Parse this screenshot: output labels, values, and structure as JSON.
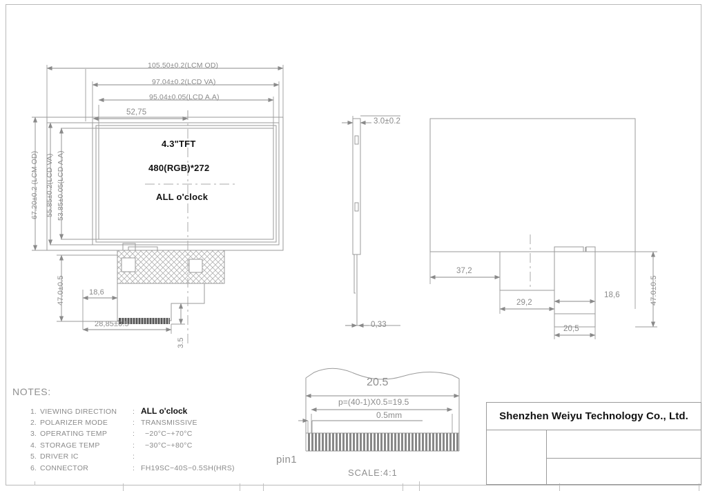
{
  "drawing": {
    "front_view": {
      "panel_texts": {
        "type": "4.3\"TFT",
        "resolution": "480(RGB)*272",
        "viewing": "ALL  o'clock"
      },
      "horizontal_dims": [
        "105.50±0.2(LCM  OD)",
        "97.04±0.2(LCD  VA)",
        "95.04±0.05(LCD  A.A)",
        "52,75"
      ],
      "vertical_dims": [
        "67.20±0.2  (LCM  OD)",
        "55.85±0.2(LCD  VA)",
        "53.85±0.05(LCD  A.A)",
        "47.0±0.5"
      ],
      "fpc_dims": [
        "18,6",
        "28,85±0.5",
        "3.5"
      ]
    },
    "side_view": {
      "thickness": "3.0±0.2",
      "fpc_thickness": "0,33"
    },
    "rear_view": {
      "dims": [
        "37,2",
        "29,2",
        "18,6",
        "20,5",
        "47.0±0.5"
      ]
    },
    "fpc_detail": {
      "width": "20.5",
      "pitch_formula": "p=(40-1)X0.5=19.5",
      "pitch": "0.5mm",
      "pin1_label": "pin1",
      "scale": "SCALE:4:1"
    }
  },
  "notes": {
    "heading": "NOTES:",
    "items": [
      {
        "num": "1.",
        "key": "VIEWING   DIRECTION",
        "colon": ":",
        "value": "ALL  o'clock",
        "strong": true
      },
      {
        "num": "2.",
        "key": "POLARIZER  MODE",
        "colon": ":",
        "value": "TRANSMISSIVE",
        "strong": false
      },
      {
        "num": "3.",
        "key": "OPERATING  TEMP",
        "colon": ":",
        "value": "−20°C~+70°C",
        "strong": false
      },
      {
        "num": "4.",
        "key": "STORAGE  TEMP",
        "colon": ":",
        "value": "−30°C~+80°C",
        "strong": false
      },
      {
        "num": "5.",
        "key": "DRIVER  IC",
        "colon": ":",
        "value": "",
        "strong": false
      },
      {
        "num": "6.",
        "key": "CONNECTOR",
        "colon": ":",
        "value": "FH19SC−40S−0.5SH(HRS)",
        "strong": false
      }
    ]
  },
  "title_block": {
    "company": "Shenzhen Weiyu Technology Co., Ltd."
  },
  "colors": {
    "line": "#9a9a9a",
    "thin_line": "#b9b9b9",
    "text": "#8a8a8a",
    "text_dark": "#111111"
  }
}
